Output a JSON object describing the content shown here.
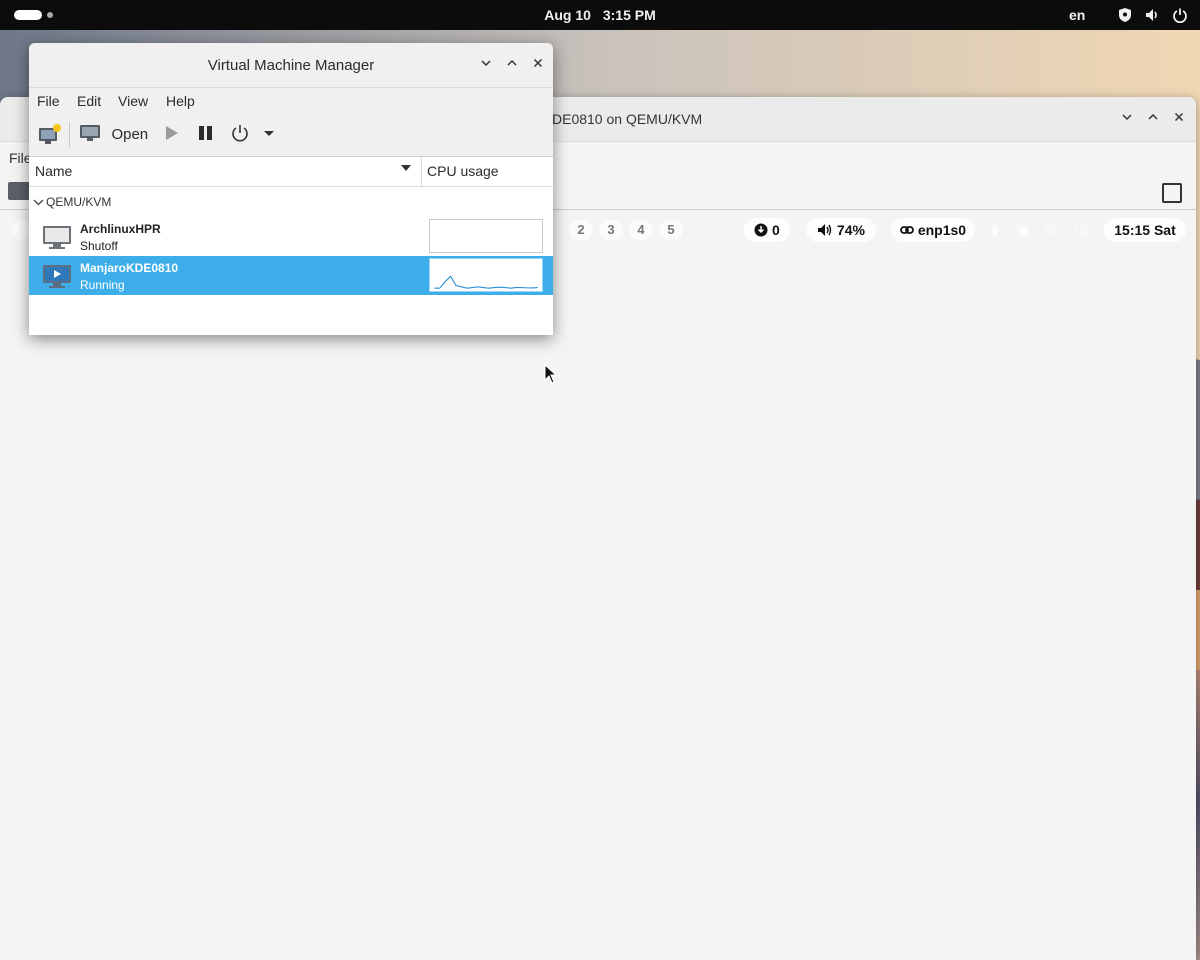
{
  "topbar": {
    "date": "Aug 10",
    "time": "3:15 PM",
    "lang": "en",
    "tray_icons": [
      "shield-icon",
      "volume-icon",
      "power-icon"
    ]
  },
  "viewer": {
    "title": "ManjaroKDE0810 on QEMU/KVM",
    "title_visible": "DE0810 on QEMU/KVM",
    "menu_file": "File"
  },
  "guest_panel": {
    "workspaces": [
      "2",
      "3",
      "4",
      "5"
    ],
    "downloads": "0",
    "volume": "74%",
    "network": "enp1s0",
    "clock": "15:15 Sat"
  },
  "vmm": {
    "title": "Virtual Machine Manager",
    "menu": [
      "File",
      "Edit",
      "View",
      "Help"
    ],
    "toolbar": {
      "open_label": "Open"
    },
    "columns": {
      "name": "Name",
      "cpu": "CPU usage"
    },
    "group": "QEMU/KVM",
    "vms": [
      {
        "name": "ArchlinuxHPR",
        "status": "Shutoff",
        "cpu": [
          0,
          0,
          0,
          0,
          0,
          0,
          0,
          0,
          0,
          0,
          0,
          0,
          0,
          0,
          0,
          0,
          0,
          0,
          0,
          0
        ]
      },
      {
        "name": "ManjaroKDE0810",
        "status": "Running",
        "cpu": [
          0,
          0,
          0.5,
          0.9,
          0.2,
          0.1,
          0,
          0.05,
          0.1,
          0.05,
          0,
          0.05,
          0.08,
          0.05,
          0,
          0.04,
          0.05,
          0.03,
          0.02,
          0.04
        ]
      }
    ]
  },
  "colors": {
    "selection": "#3daee9",
    "topbar": "#0c0c0c"
  }
}
